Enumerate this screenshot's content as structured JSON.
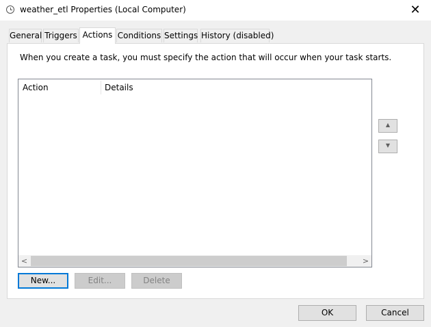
{
  "window": {
    "title": "weather_etl Properties (Local Computer)",
    "close_symbol": "✕"
  },
  "tabs": [
    {
      "label": "General"
    },
    {
      "label": "Triggers"
    },
    {
      "label": "Actions",
      "active": true
    },
    {
      "label": "Conditions"
    },
    {
      "label": "Settings"
    },
    {
      "label": "History (disabled)"
    }
  ],
  "actions_tab": {
    "description": "When you create a task, you must specify the action that will occur when your task starts.",
    "columns": [
      "Action",
      "Details"
    ],
    "rows": [],
    "scroll_left": "<",
    "scroll_right": ">",
    "move_up": "▲",
    "move_down": "▼",
    "new_label": "New...",
    "edit_label": "Edit...",
    "delete_label": "Delete"
  },
  "footer": {
    "ok_label": "OK",
    "cancel_label": "Cancel"
  },
  "icons": {
    "title": "clock-icon",
    "close": "close-icon"
  }
}
